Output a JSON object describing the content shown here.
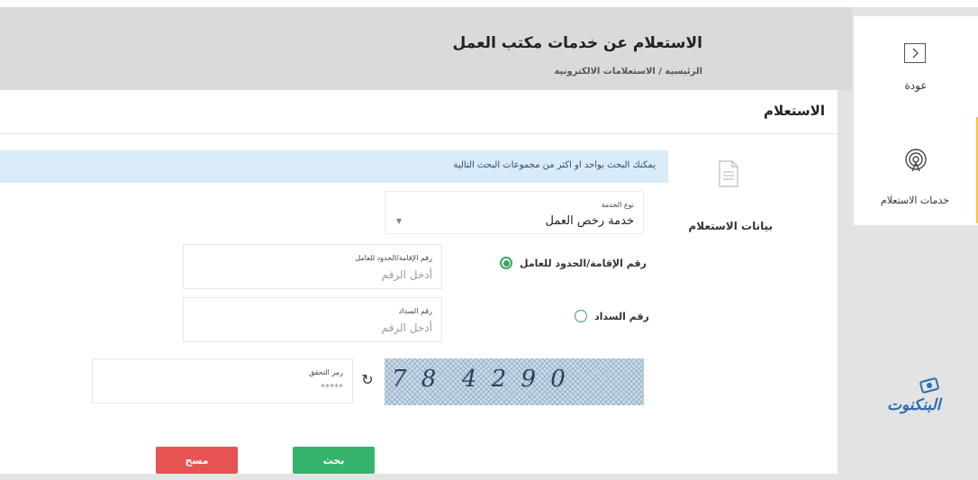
{
  "header": {
    "title": "الاستعلام عن خدمات مكتب العمل",
    "breadcrumb": "الرئيسية / الاستعلامات الالكترونية"
  },
  "sidebar": {
    "back_label": "عودة",
    "services_label": "خدمات الاستعلام"
  },
  "logo": {
    "text": "البنكنوت"
  },
  "card": {
    "title": "الاستعلام",
    "section_label": "بيانات الاستعلام",
    "info_text": "يمكنك البحث بواحد او اكثر من مجموعات البحث التالية"
  },
  "form": {
    "service_type": {
      "label": "نوع الخدمة",
      "value": "خدمة رخص العمل"
    },
    "options": [
      {
        "label": "رقم الإقامة/الحدود للعامل",
        "selected": true
      },
      {
        "label": "رقم السداد",
        "selected": false
      }
    ],
    "iqama_field": {
      "label": "رقم الإقامة/الحدود للعامل",
      "placeholder": "أدخل الرقم"
    },
    "payment_field": {
      "label": "رقم السداد",
      "placeholder": "أدخل الرقم"
    },
    "captcha_field": {
      "label": "رمز التحقق",
      "placeholder": "*****"
    },
    "captcha_image_text": "7 8  4 2 9 0"
  },
  "buttons": {
    "search": "بحث",
    "clear": "مسح"
  },
  "colors": {
    "success": "#35b36a",
    "danger": "#e55353",
    "info_bg": "#d9eaf8",
    "accent": "#f0c43a"
  }
}
